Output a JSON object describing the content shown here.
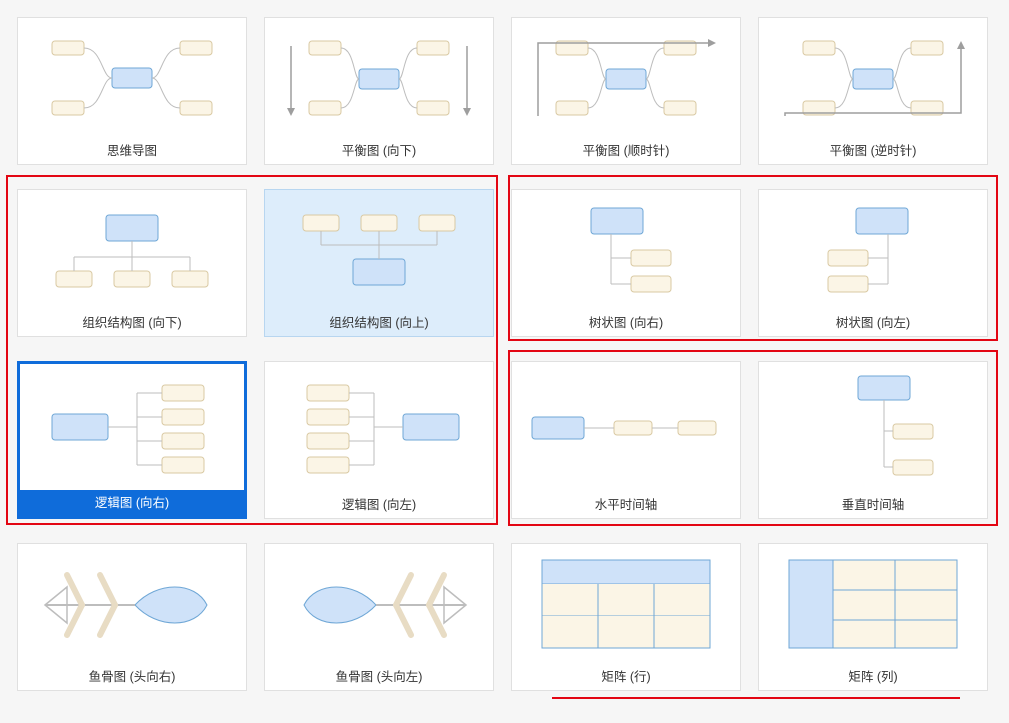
{
  "layout_names": {
    "mindmap": "思维导图",
    "balanced_down": "平衡图 (向下)",
    "balanced_cw": "平衡图 (顺时针)",
    "balanced_ccw": "平衡图 (逆时针)",
    "org_down": "组织结构图 (向下)",
    "org_up": "组织结构图 (向上)",
    "tree_right": "树状图 (向右)",
    "tree_left": "树状图 (向左)",
    "logic_right": "逻辑图 (向右)",
    "logic_left": "逻辑图 (向左)",
    "timeline_h": "水平时间轴",
    "timeline_v": "垂直时间轴",
    "fish_right": "鱼骨图 (头向右)",
    "fish_left": "鱼骨图 (头向左)",
    "matrix_row": "矩阵 (行)",
    "matrix_col": "矩阵 (列)"
  },
  "state": {
    "selected_id": "logic_right",
    "hovered_id": "org_up"
  },
  "colors": {
    "node_blue_fill": "#cfe2f9",
    "node_blue_stroke": "#6fa7d6",
    "node_cream_fill": "#fbf5e6",
    "node_cream_stroke": "#d9c9a3",
    "connector": "#bdbdbd",
    "arrow": "#9e9e9e",
    "matrix_stroke": "#6fa7d6",
    "matrix_fill": "#cfe2f9",
    "fish_fill": "#cfe2f9",
    "fish_stroke": "#6fa7d6",
    "bone": "#e8dcc4"
  }
}
